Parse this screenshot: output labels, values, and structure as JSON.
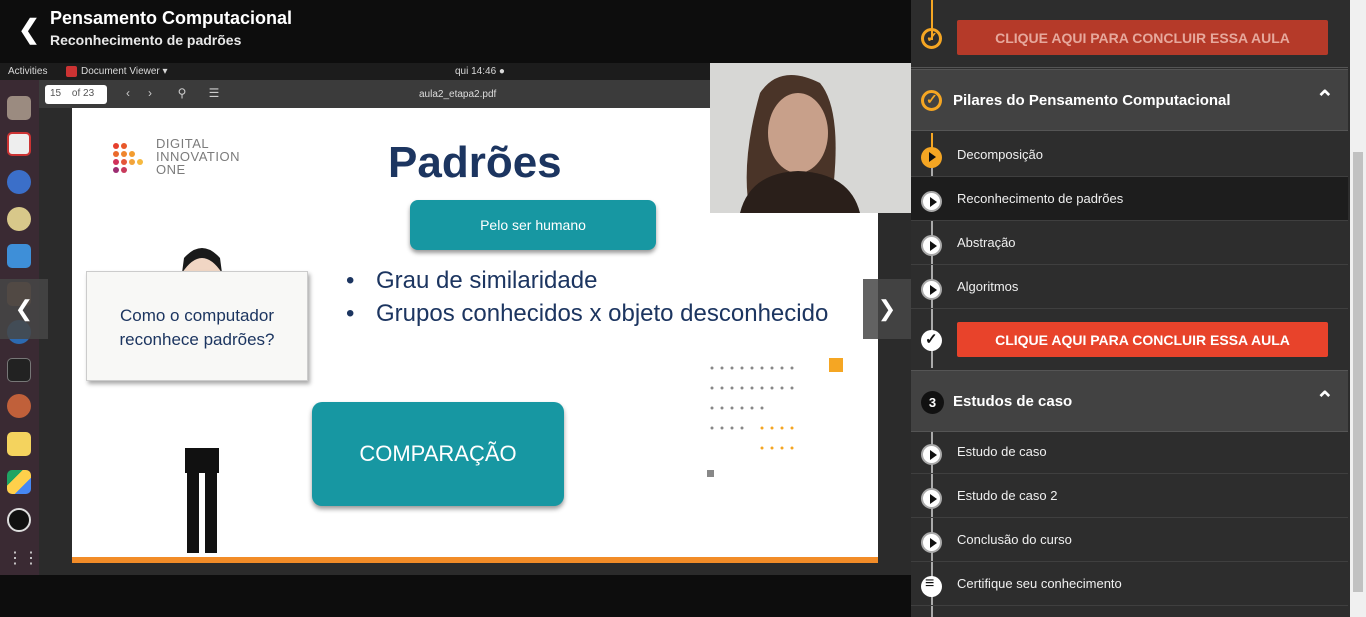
{
  "header": {
    "course_title": "Pensamento Computacional",
    "lesson_title": "Reconhecimento de padrões"
  },
  "desktop": {
    "activities": "Activities",
    "app_menu": "Document Viewer ▾",
    "clock": "qui 14:46 ●",
    "page_current": "15",
    "page_total": "of 23",
    "file_name": "aula2_etapa2.pdf"
  },
  "slide": {
    "logo_line1": "DIGITAL",
    "logo_line2": "INNOVATION",
    "logo_line3": "ONE",
    "title": "Padrões",
    "bubble": "Pelo ser humano",
    "bullets": [
      "Grau de similaridade",
      "Grupos conhecidos x objeto desconhecido"
    ],
    "board_line1": "Como o computador",
    "board_line2": "reconhece padrões?",
    "compare": "COMPARAÇÃO"
  },
  "sidebar": {
    "top_button": "CLIQUE AQUI PARA CONCLUIR ESSA AULA",
    "section1": {
      "title": "Pilares do Pensamento Computacional",
      "items": [
        {
          "label": "Decomposição",
          "state": "current"
        },
        {
          "label": "Reconhecimento de padrões",
          "state": "active"
        },
        {
          "label": "Abstração",
          "state": "todo"
        },
        {
          "label": "Algoritmos",
          "state": "todo"
        }
      ],
      "button": "CLIQUE AQUI PARA CONCLUIR ESSA AULA"
    },
    "section2": {
      "number": "3",
      "title": "Estudos de caso",
      "items": [
        {
          "label": "Estudo de caso"
        },
        {
          "label": "Estudo de caso 2"
        },
        {
          "label": "Conclusão do curso"
        },
        {
          "label": "Certifique seu conhecimento"
        }
      ]
    }
  },
  "colors": {
    "accent": "#e8432b",
    "progress": "#f5a623",
    "slide_teal": "#1797a2",
    "slide_navy": "#1c3560"
  }
}
